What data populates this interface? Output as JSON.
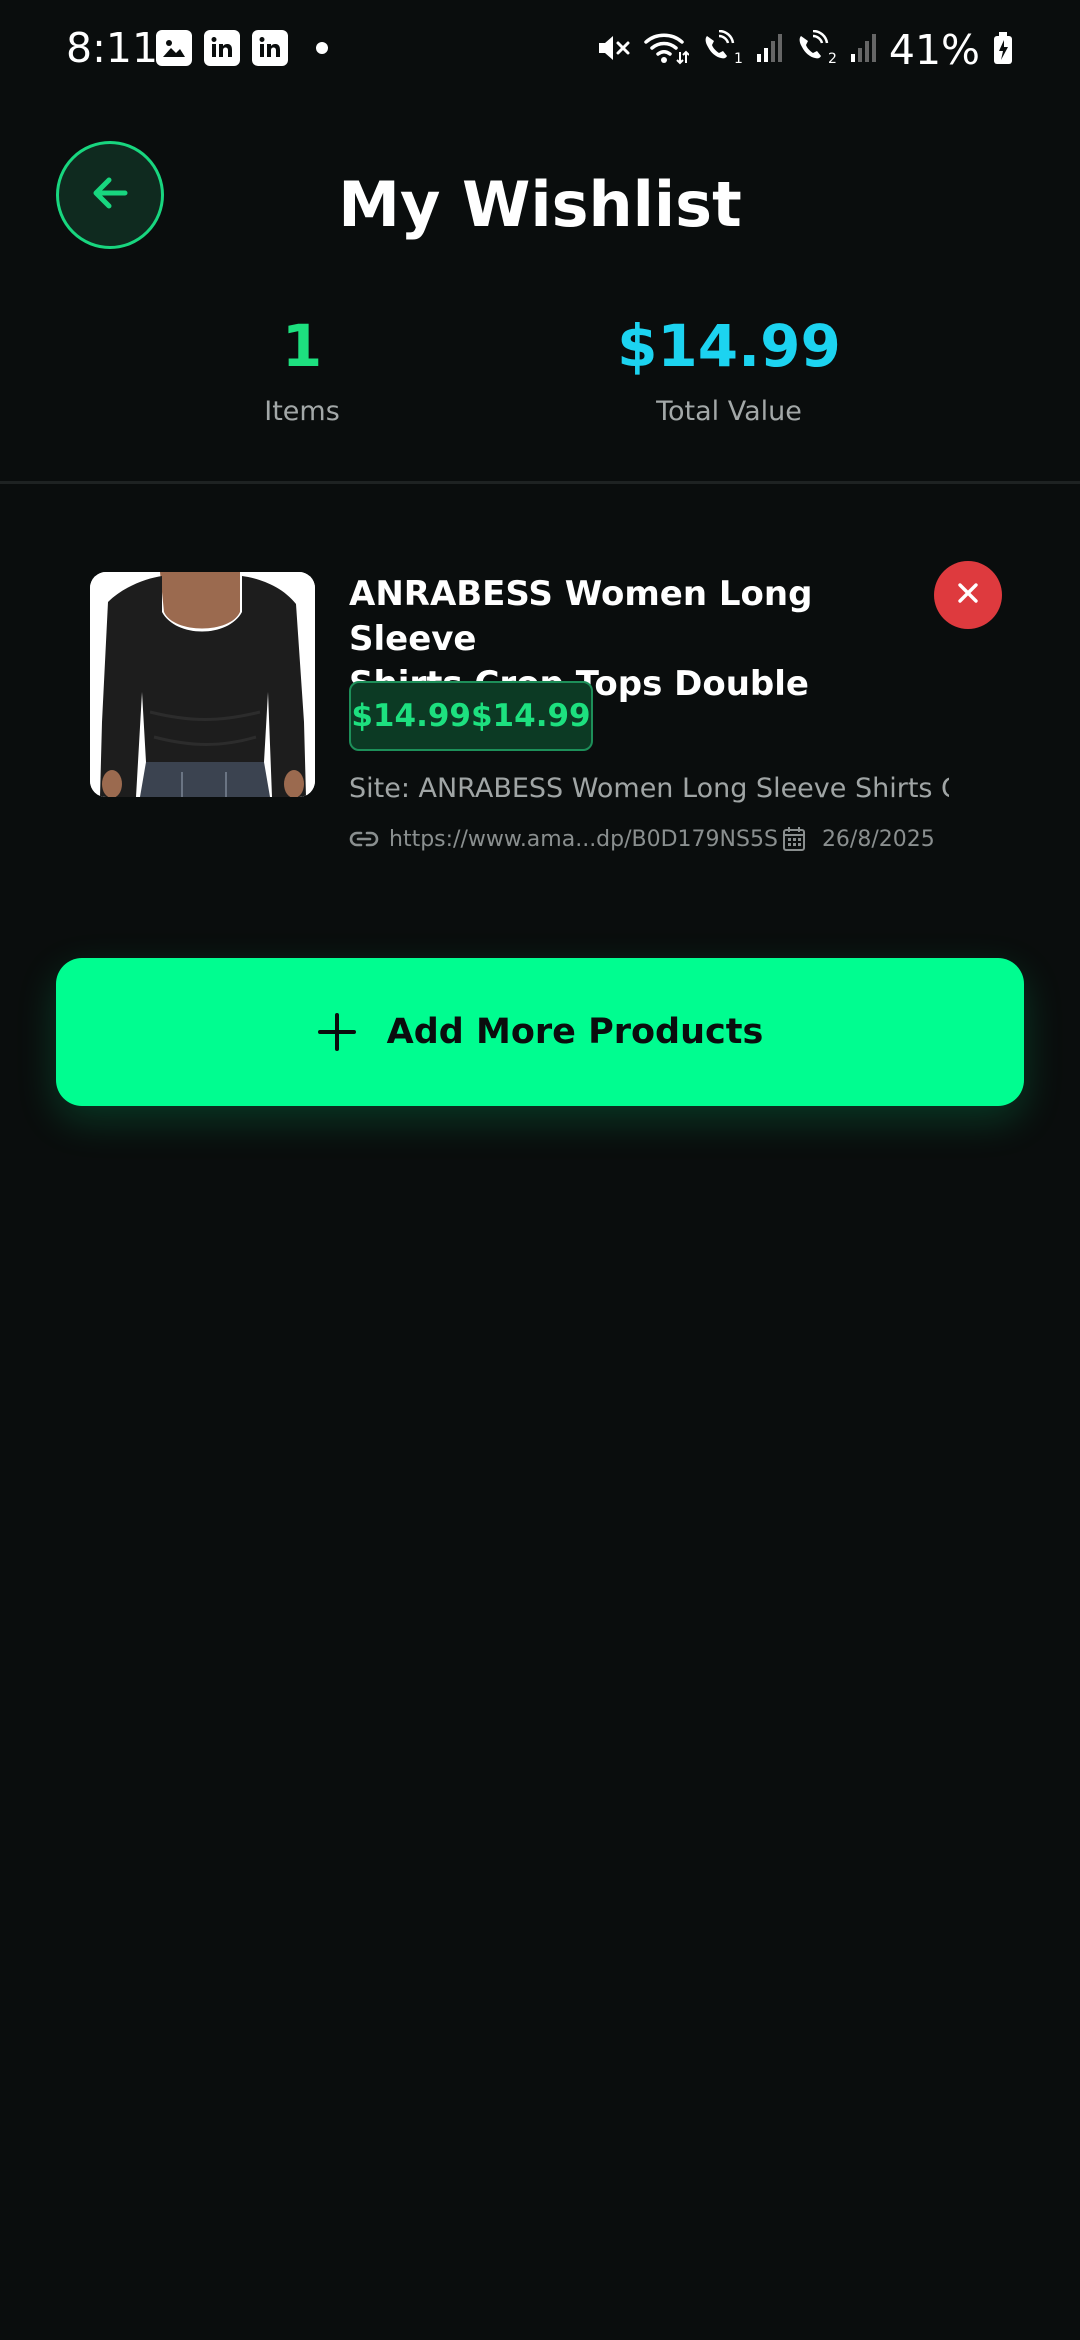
{
  "status_bar": {
    "time": "8:11",
    "battery": "41%"
  },
  "header": {
    "title": "My Wishlist"
  },
  "stats": {
    "items_value": "1",
    "items_label": "Items",
    "total_value": "$14.99",
    "total_label": "Total Value"
  },
  "wishlist": {
    "items": [
      {
        "title_line1": "ANRABESS Women Long Sleeve",
        "title_line2": "Shirts Crop Tops Double Lined Sq...",
        "price": "$14.99$14.99",
        "site": "Site: ANRABESS Women Long Sleeve Shirts C...",
        "url": "https://www.ama...dp/B0D179NS5S",
        "date": "26/8/2025"
      }
    ]
  },
  "actions": {
    "add_more_label": "Add More Products"
  },
  "colors": {
    "background": "#0a0d0d",
    "accent_green": "#1de07f",
    "accent_cyan": "#1cd3f0",
    "cta_green": "#00fd90",
    "danger": "#de3a3e"
  },
  "icons": {
    "back": "arrow-left-icon",
    "remove": "close-icon",
    "link": "link-icon",
    "date": "calendar-icon",
    "add": "plus-icon"
  }
}
